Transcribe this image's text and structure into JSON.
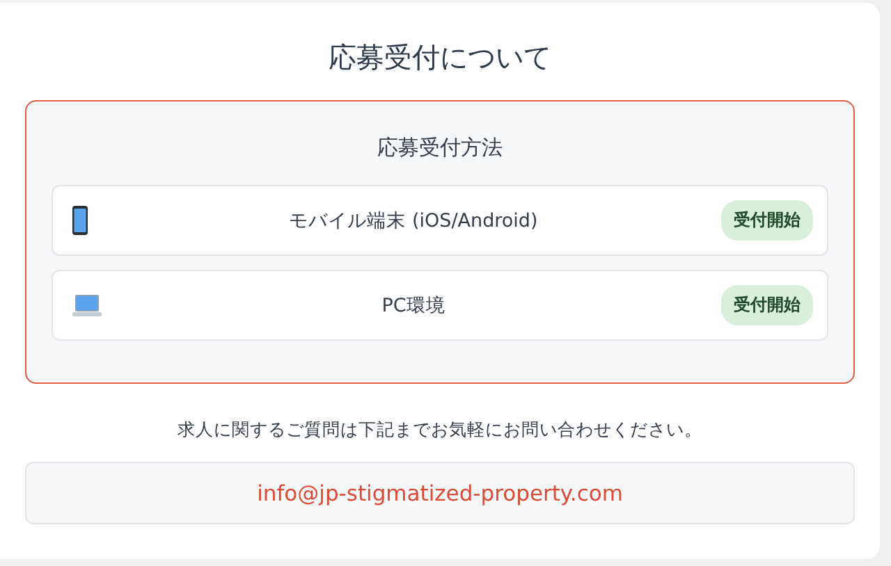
{
  "title": "応募受付について",
  "methods_panel": {
    "heading": "応募受付方法",
    "methods": [
      {
        "kind": "mobile",
        "label": "モバイル端末 (iOS/Android)",
        "status": "受付開始"
      },
      {
        "kind": "pc",
        "label": "PC環境",
        "status": "受付開始"
      }
    ]
  },
  "contact": {
    "note": "求人に関するご質問は下記までお気軽にお問い合わせください。",
    "email": "info@jp-stigmatized-property.com"
  }
}
